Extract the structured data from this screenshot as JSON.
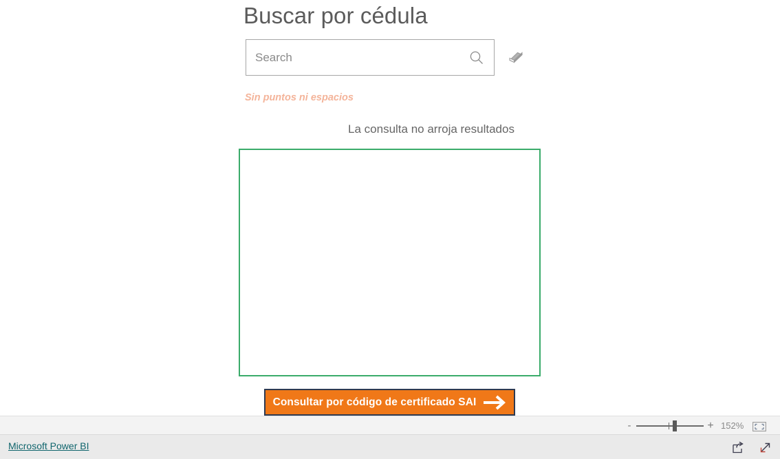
{
  "report": {
    "title": "Buscar por cédula",
    "search": {
      "placeholder": "Search",
      "value": "",
      "search_icon": "search-icon",
      "clear_icon": "eraser-icon"
    },
    "hint": "Sin puntos ni espacios",
    "no_results_message": "La consulta no arroja resultados",
    "action_button": {
      "label": "Consultar por código de certificado SAI",
      "icon": "arrow-right-icon"
    },
    "colors": {
      "title_gray": "#5b5b5b",
      "hint_peach": "#f4b49a",
      "results_border_green": "#3aab6a",
      "button_orange": "#f07818",
      "button_border_navy": "#2d3a52",
      "link_teal": "#10656d"
    }
  },
  "zoom_toolbar": {
    "zoom_out_label": "-",
    "zoom_in_label": "+",
    "zoom_level": "152%",
    "fit_icon": "fit-to-page-icon"
  },
  "footer": {
    "brand_link": "Microsoft Power BI",
    "share_icon": "share-icon",
    "fullscreen_icon": "fullscreen-icon"
  }
}
